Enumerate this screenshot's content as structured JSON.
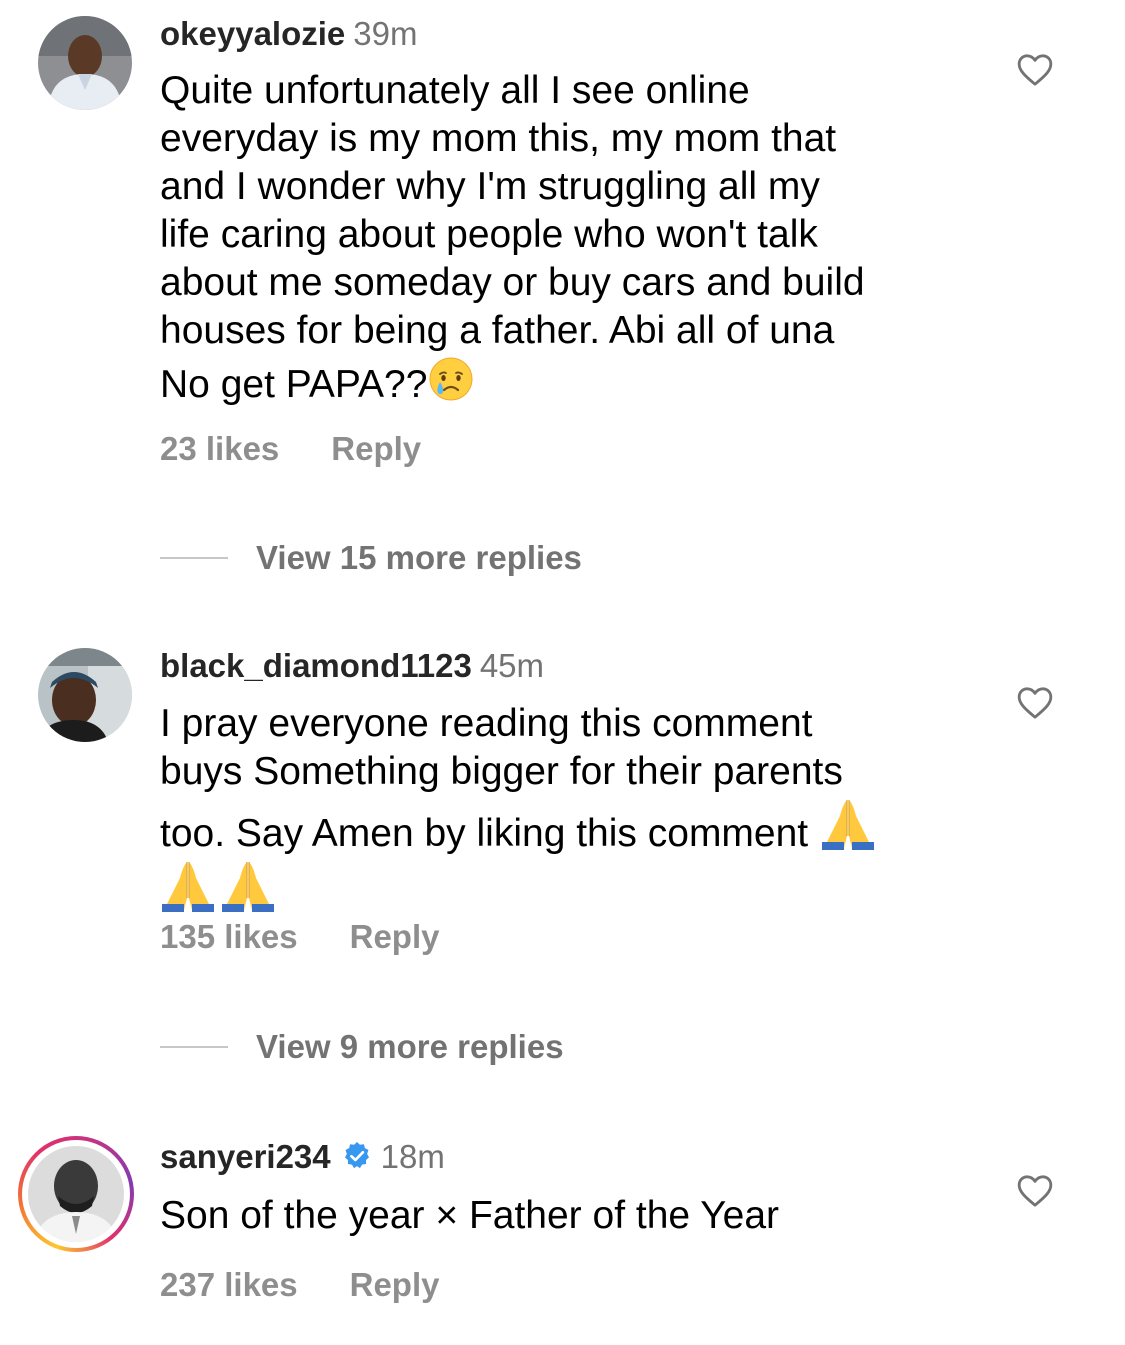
{
  "comments": [
    {
      "username": "okeyyalozie",
      "time": "39m",
      "verified": false,
      "lines": [
        "Quite unfortunately all I see online",
        "everyday is my mom this, my mom that",
        "and I wonder why I'm struggling all my",
        "life caring about people who won't talk",
        "about me someday or buy cars and build",
        "houses for being a father. Abi all of una",
        "No get PAPA??"
      ],
      "likes": "23 likes",
      "reply": "Reply",
      "view_replies": "View 15 more replies",
      "icons": [
        "crying-face-emoji",
        "heart-outline-icon"
      ]
    },
    {
      "username": "black_diamond1123",
      "time": "45m",
      "verified": false,
      "lines": [
        "I pray everyone reading this comment",
        "buys Something bigger for their parents",
        "too. Say Amen by liking this comment"
      ],
      "likes": "135 likes",
      "reply": "Reply",
      "view_replies": "View 9 more replies",
      "icons": [
        "folded-hands-emoji",
        "heart-outline-icon"
      ]
    },
    {
      "username": "sanyeri234",
      "time": "18m",
      "verified": true,
      "lines": [
        "Son of the year × Father of the Year"
      ],
      "likes": "237 likes",
      "reply": "Reply",
      "icons": [
        "verified-badge-icon",
        "story-ring",
        "heart-outline-icon"
      ]
    }
  ],
  "colors": {
    "username": "#262626",
    "timestamp": "#737373",
    "meta": "#8e8e8e",
    "verified": "#3897f0"
  }
}
